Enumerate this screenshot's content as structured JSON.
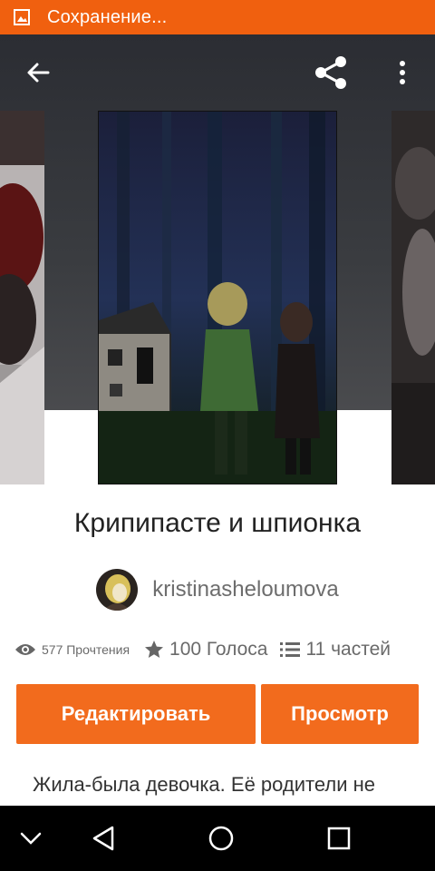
{
  "status_bar": {
    "icon": "image-icon",
    "text": "Сохранение...",
    "color": "#f0600f"
  },
  "toolbar": {
    "back_icon": "arrow-back-icon",
    "share_icon": "share-icon",
    "more_icon": "more-vert-icon"
  },
  "story": {
    "title": "Крипипасте и шпионка",
    "author": "kristinasheloumova",
    "reads": "577 Прочтения",
    "votes": "100 Голоса",
    "parts": "11 частей",
    "description": "Жила-была девочка. Её родители не"
  },
  "actions": {
    "edit_label": "Редактировать",
    "view_label": "Просмотр",
    "button_color": "#f26b1d"
  },
  "nav_bar": {
    "icons": [
      "chevron-down-icon",
      "back-triangle-icon",
      "home-circle-icon",
      "recent-square-icon"
    ]
  }
}
